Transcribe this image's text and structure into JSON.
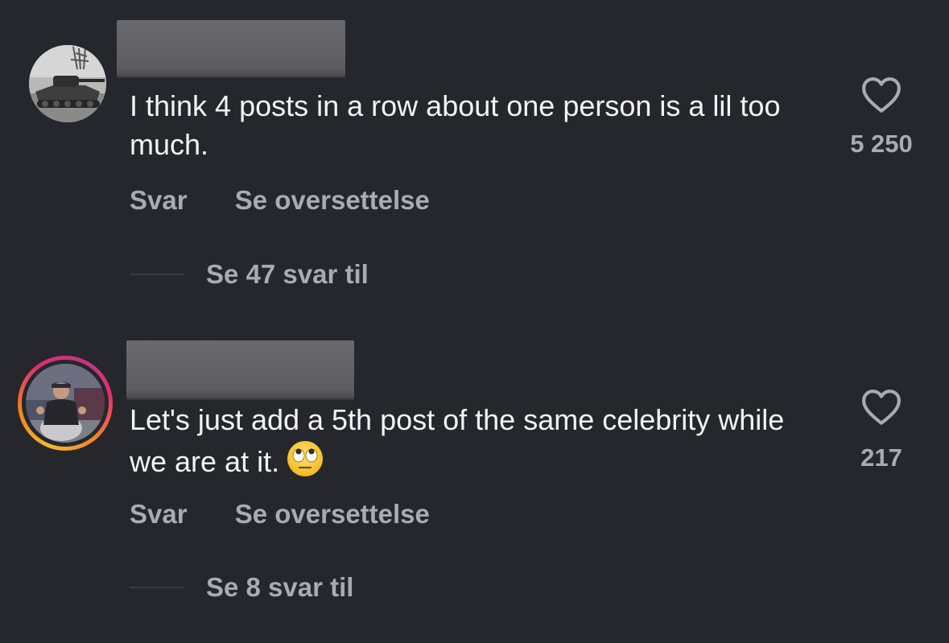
{
  "comments": [
    {
      "author_visible": false,
      "avatar": "tank-photo-avatar",
      "avatar_has_story_ring": false,
      "text": "I think 4 posts in a row about one person is a lil too much.",
      "reply_label": "Svar",
      "translate_label": "Se oversettelse",
      "view_replies_label": "Se 47 svar til",
      "like_count": "5 250",
      "like_icon": "heart-outline-icon"
    },
    {
      "author_visible": false,
      "avatar": "person-photo-avatar",
      "avatar_has_story_ring": true,
      "text": "Let's just add a 5th post of the same celebrity while we are at it.",
      "emoji": "face-with-rolling-eyes",
      "reply_label": "Svar",
      "translate_label": "Se oversettelse",
      "view_replies_label": "Se 8 svar til",
      "like_count": "217",
      "like_icon": "heart-outline-icon"
    }
  ],
  "colors": {
    "background": "#25272c",
    "text_primary": "#f2f3f5",
    "text_secondary": "#a8abb3"
  }
}
